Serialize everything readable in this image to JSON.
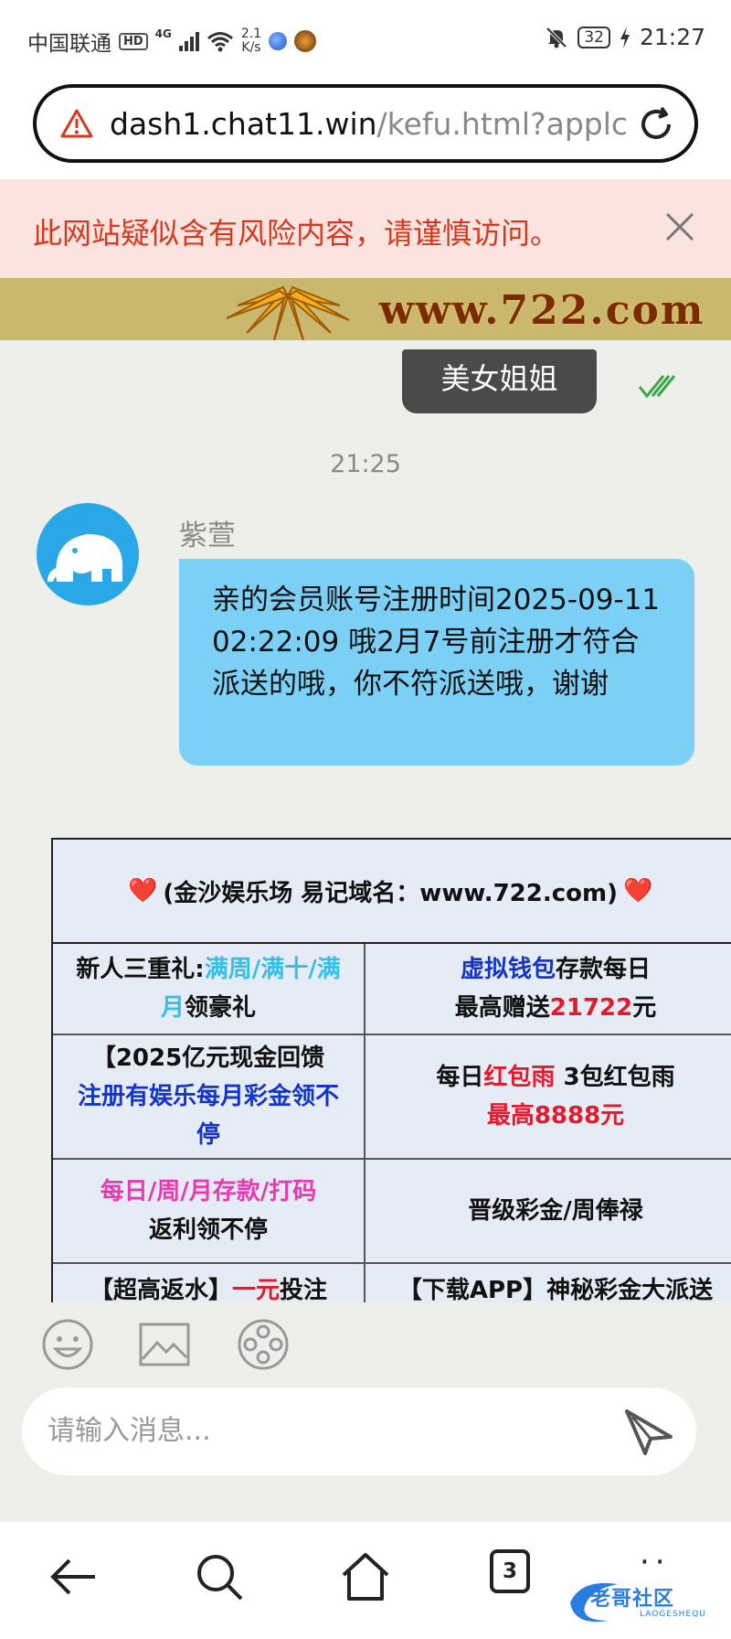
{
  "status_bar": {
    "carrier": "中国联通",
    "hd": "HD",
    "network": "4G",
    "speed_value": "2.1",
    "speed_unit": "K/s",
    "battery": "32",
    "time": "21:27"
  },
  "address_bar": {
    "domain": "dash1.chat11.win",
    "path": "/kefu.html?applc"
  },
  "warning": {
    "text": "此网站疑似含有风险内容，请谨慎访问。"
  },
  "hero": {
    "site": "www.722.com"
  },
  "chat": {
    "outgoing_message": "美女姐姐",
    "timestamp": "21:25",
    "sender_name": "紫萱",
    "incoming_message": "亲的会员账号注册时间2025-09-11 02:22:09 哦2月7号前注册才符合派送的哦，你不符派送哦，谢谢"
  },
  "promo": {
    "heart": "❤️",
    "title": "(金沙娱乐场 易记域名：www.722.com)",
    "r1c1_a": "新人三重礼:",
    "r1c1_b": "满周/满十/满",
    "r1c1_c": "月",
    "r1c1_d": "领豪礼",
    "r1c2_a": "虚拟钱包",
    "r1c2_b": "存款每日",
    "r1c2_c": "最高赠送",
    "r1c2_d": "21722",
    "r1c2_e": "元",
    "r2c1_a": "【2025亿元现金回馈",
    "r2c1_b": "注册有娱乐每月彩金领不",
    "r2c1_c": "停",
    "r2c2_a": "每日",
    "r2c2_b": "红包雨",
    "r2c2_c": " 3包红包雨",
    "r2c2_d": "最高8888元",
    "r3c1_a": "每日/周/月存款/打码",
    "r3c1_b": "返利领不停",
    "r3c2_a": "晋级彩金/周俸禄",
    "r4c1_a": "【超高返水】",
    "r4c1_b": "一元",
    "r4c1_c": "投注",
    "r4c2_a": "【下载APP】神秘彩金大派送"
  },
  "composer": {
    "placeholder": "请输入消息..."
  },
  "nav": {
    "tabs_count": "3",
    "watermark": "老哥社区",
    "watermark_sub": "LAOGESHEQU"
  },
  "icons": {
    "warning": "warning-triangle-icon",
    "reload": "reload-icon",
    "close": "close-icon",
    "read": "double-check-icon",
    "emoji": "emoji-icon",
    "image": "image-icon",
    "video": "film-reel-icon",
    "send": "send-icon",
    "back": "back-arrow-icon",
    "search": "search-icon",
    "home": "home-icon",
    "more": "more-dots-icon"
  },
  "colors": {
    "warning_text": "#d6381e",
    "warning_bg": "#fbe3df",
    "incoming_bubble": "#7cd0f6",
    "outgoing_bubble": "#4a4a4a"
  }
}
